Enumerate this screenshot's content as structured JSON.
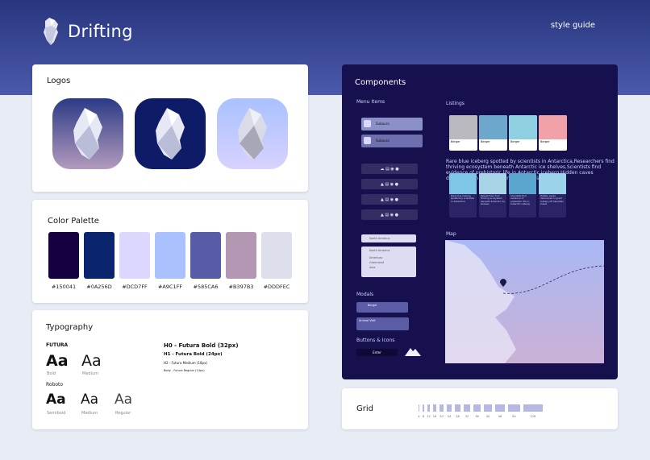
{
  "brand": {
    "name": "Drifting"
  },
  "header": {
    "link": "style guide"
  },
  "logos": {
    "title": "Logos"
  },
  "palette": {
    "title": "Color Palette",
    "colors": [
      "#150041",
      "#0A256D",
      "#DCD7FF",
      "#A9C1FF",
      "#585CA6",
      "#B397B3",
      "#DDDFEC"
    ]
  },
  "typography": {
    "title": "Typography",
    "futura": "FUTURA",
    "aa": "Aa",
    "bold": "Bold",
    "medium": "Medium",
    "roboto": "Roboto",
    "semibold": "Semibold",
    "regular": "Regular",
    "h0": "H0 - Futura Bold (32px)",
    "h1": "H1 - Futura Bold (24px)",
    "h2": "H2 - Futura Medium (18px)",
    "body": "Body - Futura Regular (14px)"
  },
  "components": {
    "title": "Components",
    "menu_items": "Menu Items",
    "listings": "Listings",
    "news": [
      "Rare blue iceberg spotted by scientists in Antarctica",
      "Researchers find thriving ecosystem beneath Antarctic ice shelves",
      "Scientists find evidence of prehistoric life in Antarctic iceberg",
      "Hidden caves discovered in giant iceberg off Canadian Coast"
    ],
    "map": "Map",
    "modals": "Modals",
    "buttons": "Buttons & Icons",
    "menu_label": "Subaura",
    "select": "North America",
    "options": [
      "Americas",
      "Greenland",
      "Asia"
    ],
    "enter": "Enter",
    "listing_title": "Berger",
    "listing_sub": "North Atlantic",
    "modal_title": "Berger",
    "modal2_title": "Animal Visit",
    "news_time": "1 month ago"
  },
  "grid": {
    "title": "Grid",
    "values": [
      "4",
      "8",
      "12",
      "16",
      "20",
      "24",
      "28",
      "32",
      "36",
      "40",
      "48",
      "64",
      "128"
    ]
  }
}
